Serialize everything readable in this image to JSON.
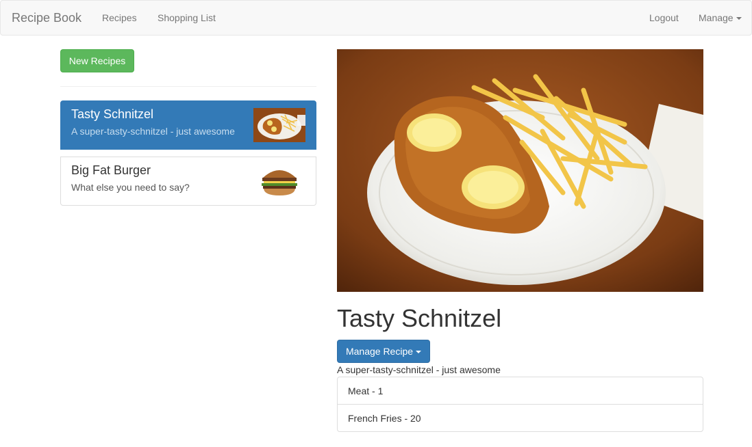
{
  "navbar": {
    "brand": "Recipe Book",
    "links": [
      "Recipes",
      "Shopping List"
    ],
    "right_links": [
      "Logout",
      "Manage"
    ]
  },
  "sidebar": {
    "new_button": "New Recipes",
    "recipes": [
      {
        "name": "Tasty Schnitzel",
        "description": "A super-tasty-schnitzel - just awesome",
        "active": true,
        "thumb": "schnitzel-thumbnail"
      },
      {
        "name": "Big Fat Burger",
        "description": "What else you need to say?",
        "active": false,
        "thumb": "burger-thumbnail"
      }
    ]
  },
  "detail": {
    "image": "schnitzel-photo",
    "title": "Tasty Schnitzel",
    "manage_button": "Manage Recipe",
    "description": "A super-tasty-schnitzel - just awesome",
    "ingredients": [
      "Meat - 1",
      "French Fries - 20"
    ]
  },
  "colors": {
    "primary": "#337ab7",
    "success": "#5cb85c",
    "navbar_bg": "#f8f8f8"
  }
}
